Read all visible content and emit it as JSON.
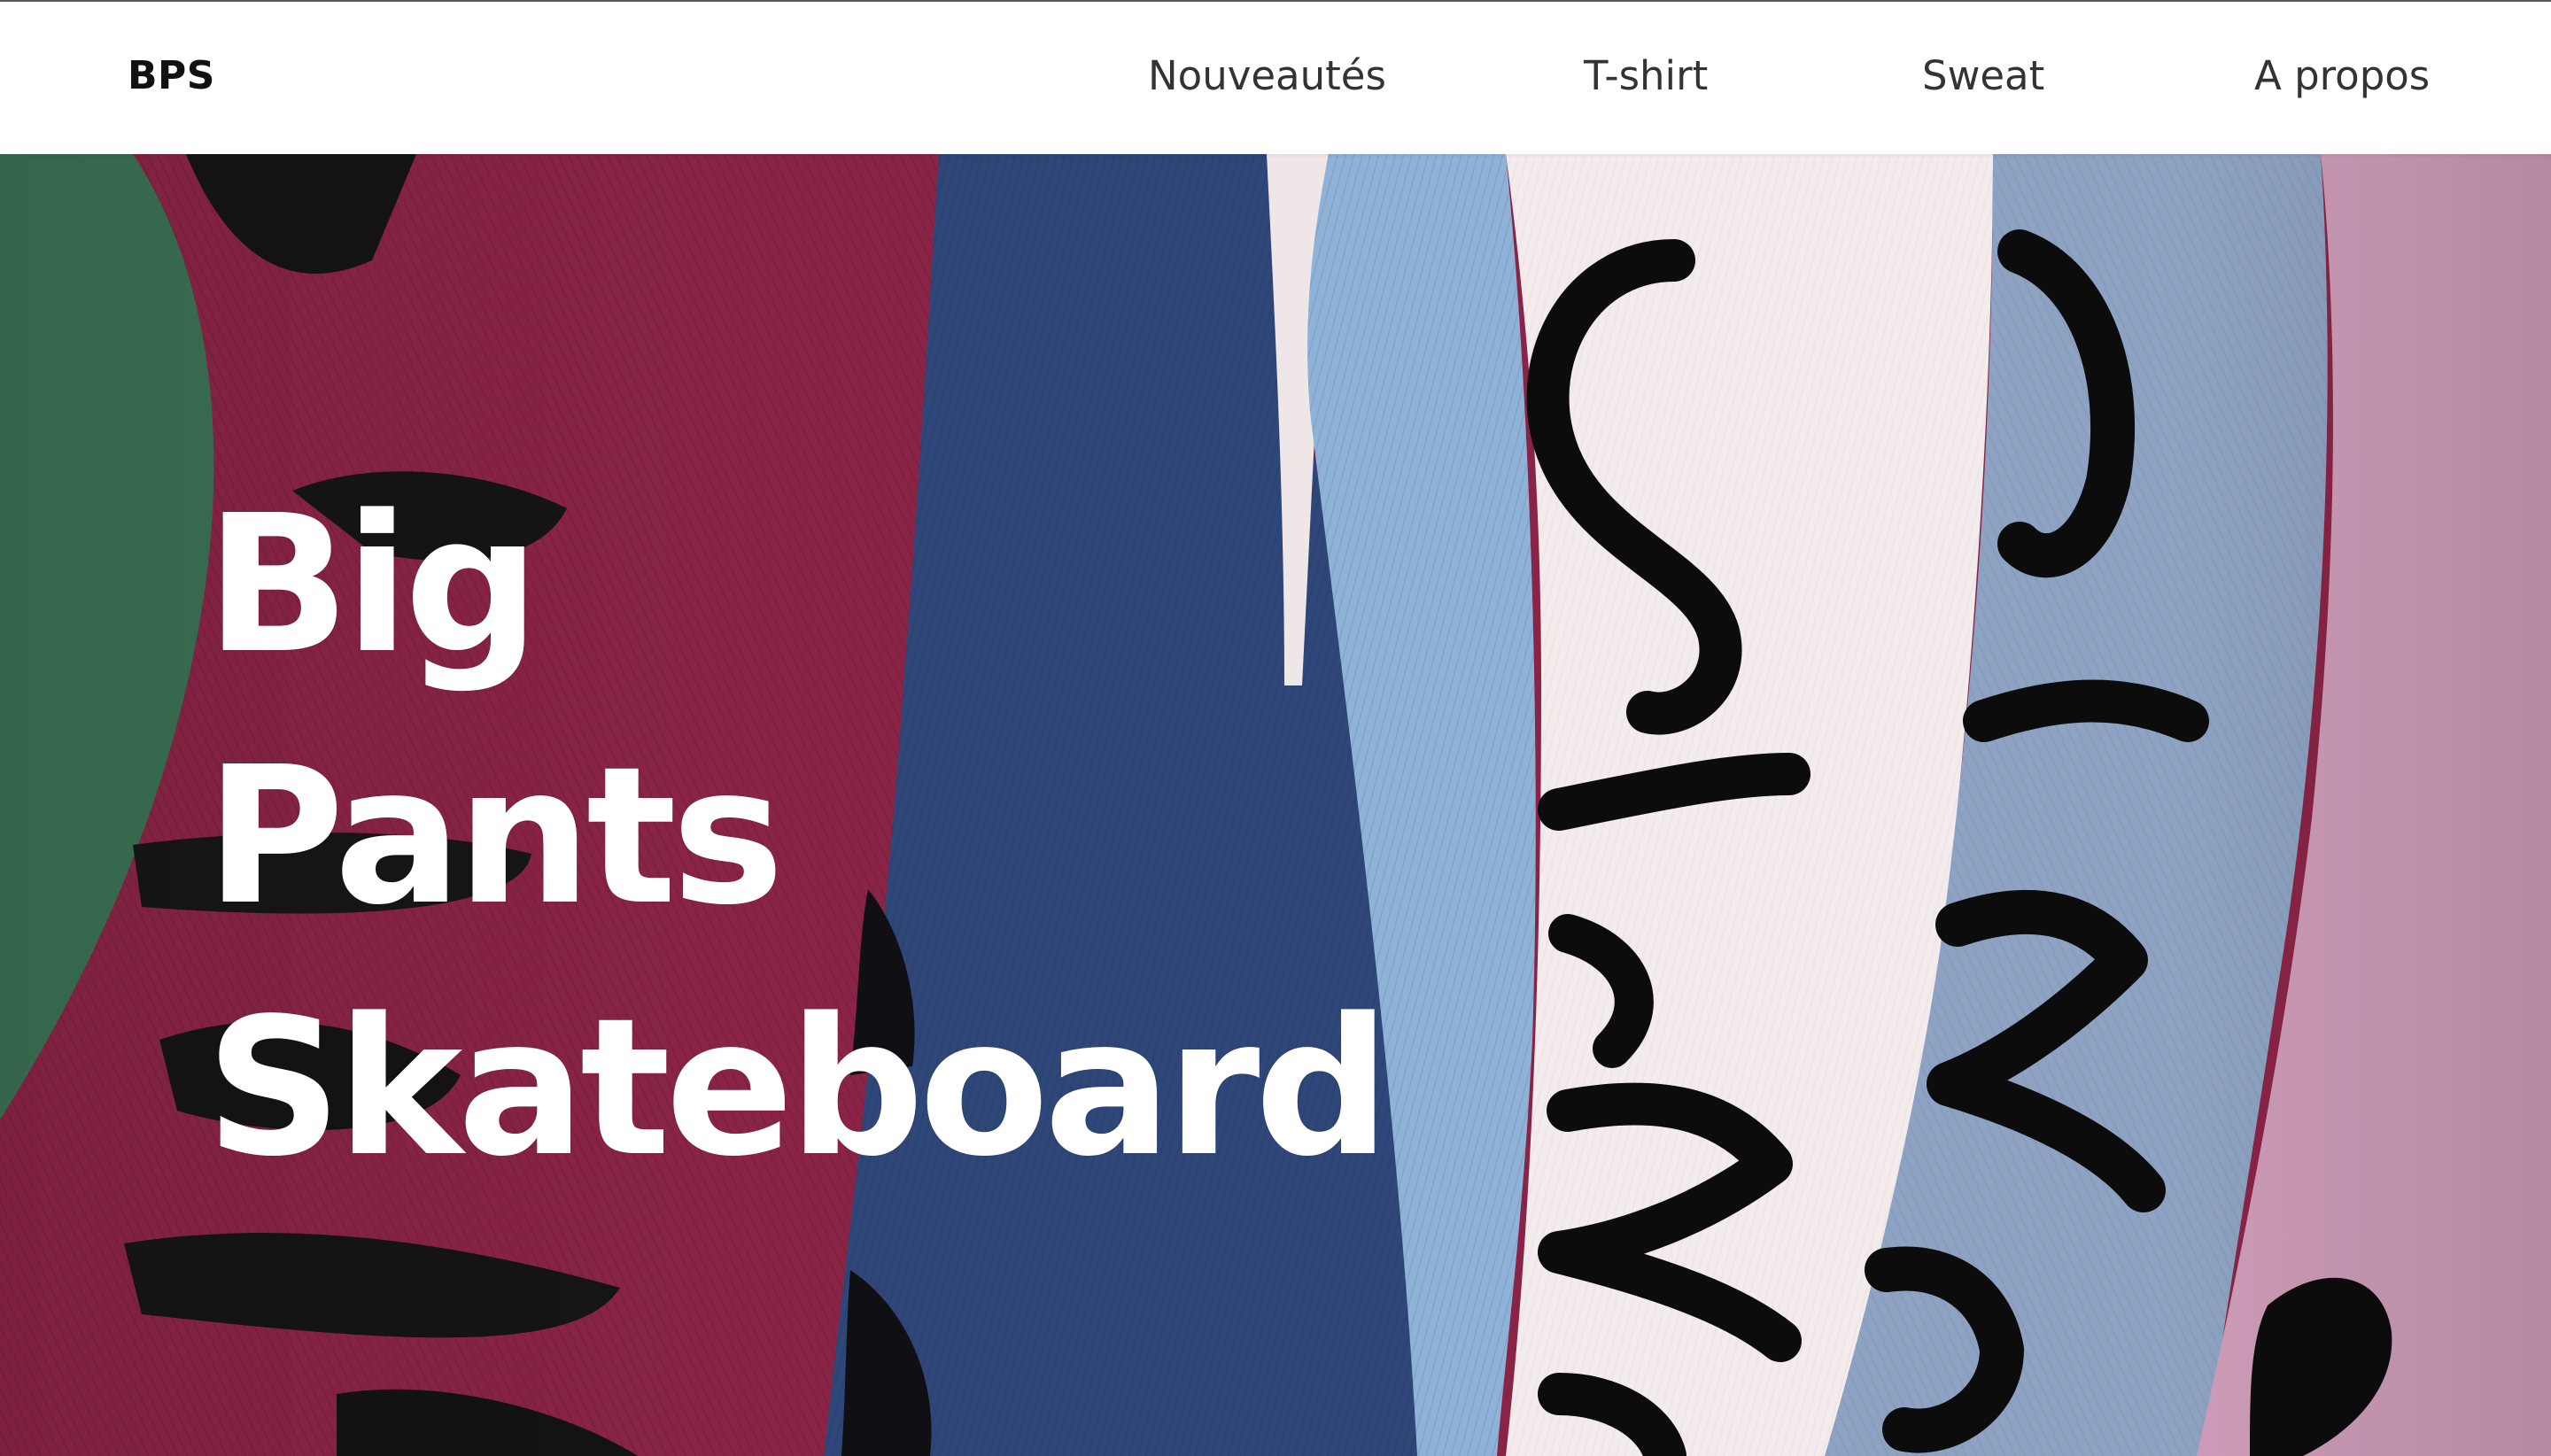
{
  "navbar": {
    "logo": "BPS",
    "links": [
      {
        "label": "Nouveautés"
      },
      {
        "label": "T-shirt"
      },
      {
        "label": "Sweat"
      },
      {
        "label": "A propos"
      }
    ]
  },
  "hero": {
    "title_lines": [
      "Big",
      "Pants",
      "Skateboard"
    ],
    "background_image": "folded colored t-shirts with black lettering",
    "colors": {
      "green": "#3f7a5c",
      "burgundy": "#8a2446",
      "navy": "#2f4678",
      "light_blue": "#8fb2d8",
      "white": "#f4ecec",
      "grey_blue": "#8ea3c3",
      "pink": "#d9a7c2"
    }
  }
}
